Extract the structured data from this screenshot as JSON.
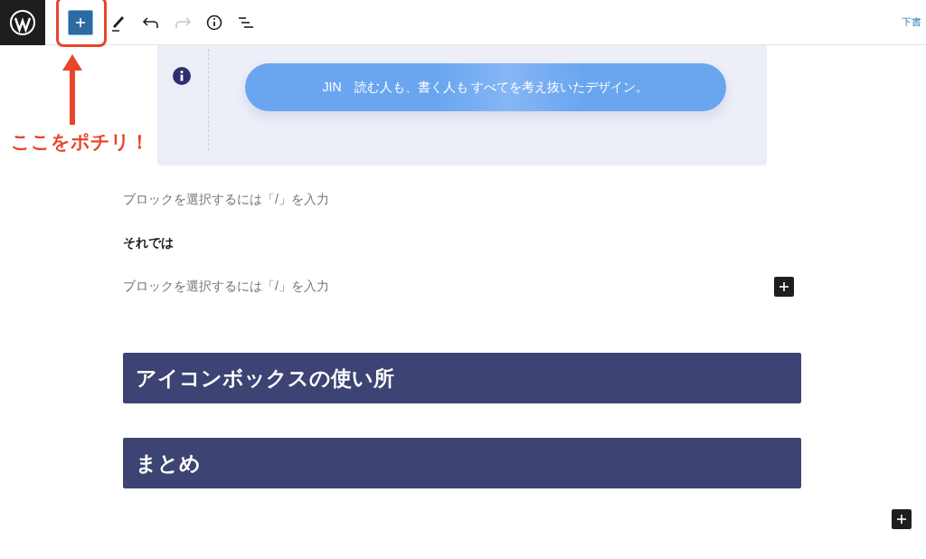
{
  "toolbar": {
    "tools": [
      {
        "kind": "inserter",
        "selected": true
      },
      {
        "kind": "edit",
        "disabled": false
      },
      {
        "kind": "undo",
        "disabled": false
      },
      {
        "kind": "redo",
        "disabled": true
      },
      {
        "kind": "info",
        "disabled": false
      },
      {
        "kind": "list",
        "disabled": false
      }
    ],
    "draft_link": "下書"
  },
  "annotation": {
    "caption": "ここをポチリ！"
  },
  "icon_box": {
    "text": "JIN　読む人も、書く人も すべてを考え抜いたデザイン。"
  },
  "blocks": [
    {
      "kind": "placeholder",
      "text": "ブロックを選択するには「/」を入力",
      "inserter": false
    },
    {
      "kind": "paragraph",
      "text": "それでは"
    },
    {
      "kind": "placeholder",
      "text": "ブロックを選択するには「/」を入力",
      "inserter": true
    },
    {
      "kind": "heading",
      "text": "アイコンボックスの使い所"
    },
    {
      "kind": "heading",
      "text": "まとめ"
    }
  ]
}
